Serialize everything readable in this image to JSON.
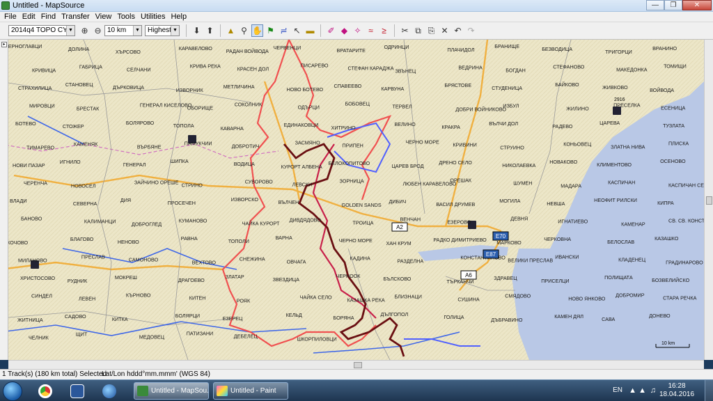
{
  "window": {
    "title": "Untitled - MapSource"
  },
  "menu": [
    "File",
    "Edit",
    "Find",
    "Transfer",
    "View",
    "Tools",
    "Utilities",
    "Help"
  ],
  "toolbar": {
    "map_product": "2014q4 TOPO CYR",
    "zoom_scale": "10 km",
    "detail_level": "Highest"
  },
  "map": {
    "labels": [
      "ЧЕРНОГЛАВЦИ",
      "ДОЛИНА",
      "ХЪРСОВО",
      "КАРАВЕЛОВО",
      "РАДАН ВОЙВОДА",
      "ЧЕРВЕНЦИ",
      "ВРАТАРИТЕ",
      "ОДРИНЦИ",
      "ПЛАЧИДОЛ",
      "БРАНИЩЕ",
      "БЕЗВОДИЦА",
      "ТРИГОРЦИ",
      "ВРАНИНО",
      "КРИВИЦА",
      "ГАБРИЦА",
      "СЕЛЧАНИ",
      "КРИВА РЕКА",
      "КРАСЕН ДОЛ",
      "ПИСАРЕВО",
      "СТЕФАН КАРАДЖА",
      "ЗВЪНЕЦ",
      "ВЕДРИНА",
      "БОГДАН",
      "СТЕФАНОВО",
      "МАКЕДОНКА",
      "ТОМИЩИ",
      "СТРАХИЛИЦА",
      "СТАНОВЕЦ",
      "ДЪРКОВИЦА",
      "ИЗВОРНИК",
      "МЕТЛИЧИНА",
      "НОВО БОТЕВО",
      "СПАВЕЕВО",
      "КАРВУНА",
      "БРЯСТОВЕ",
      "СТУДЕНИЦА",
      "БАЙКОВО",
      "ЖИВКОВО",
      "ВОЙВОДА",
      "МИРОВЦИ",
      "БРЕСТАК",
      "ГЕНЕРАЛ КИСЕЛОВО",
      "ОБОРИЩЕ",
      "СОКОЛНИК",
      "ОДЪРЦИ",
      "БОБОВЕЦ",
      "ТЕРВЕЛ",
      "ДОБРИ ВОЙНИКОВО",
      "ИЗБУЛ",
      "ЖИЛИНО",
      "ПРЕСЕЛКА",
      "ЕСЕНИЦА",
      "БОТЕВО",
      "СТОЖЕР",
      "БОЛЯРОВО",
      "ТОПОЛА",
      "КАВАРНА",
      "ЕДИНАКОВЦИ",
      "ХИТРИНО",
      "ВЕЛИНО",
      "КРАКРА",
      "ВЪЛЧИ ДОЛ",
      "РАДЕВО",
      "ЦАРЕВА",
      "ТУЗЛАТА",
      "ТИМАРЕВО",
      "КАМЕНЯК",
      "ВЪРБЯНЕ",
      "ПАМУКЧИИ",
      "ДОБРОТИЧ",
      "ЗАСМЯНО",
      "ПРИПЕН",
      "ЧЕРНО МОРЕ",
      "КРИВИНИ",
      "СТРУИНО",
      "КОНЬОВЕЦ",
      "ЗЛАТНА НИВА",
      "ПЛИСКА",
      "НОВИ ПАЗАР",
      "ИГНИЛО",
      "ГЕНЕРАЛ",
      "ШИПКА",
      "ВОДИЦА",
      "КУРОРТ АЛБЕНА",
      "БЕЛОКОПИТОВО",
      "ЦАРЕВ БРОД",
      "ДРЕНО СЕЛО",
      "НИКОЛАЕВКА",
      "НОВАКОВО",
      "КЛИМЕНТОВО",
      "ОСЕНОВО",
      "ЧЕРЕНЧА",
      "НОВОСЕЛ",
      "ЗАЙЧИНО ОРЕШЕ",
      "СТРИНО",
      "СУВОРОВО",
      "ЛЕВСКИ",
      "ЗОРНИЦА",
      "ЛЮБЕН КАРАВЕЛОВО",
      "ОРЕШАК",
      "ШУМЕН",
      "МАДАРА",
      "КАСПИЧАН",
      "КАСПИЧАН СЕЛО",
      "ВЛАДИ",
      "СЕВЕРНА",
      "ДИЯ",
      "ПРОСЕЧЕН",
      "ИЗВОРСКО",
      "ВЪЛЧЕН",
      "GOLDEN SANDS",
      "ДИБИЧ",
      "ВАСИЛ ДРУМЕВ",
      "МОГИЛА",
      "НЕВША",
      "НЕОФИТ РИЛСКИ",
      "КИПРА",
      "БАНОВО",
      "КАЛИМАНЦИ",
      "ДОБРОГЛЕД",
      "КУМАНОВО",
      "ЧАЙКА КУРОРТ",
      "ДИВДЯДОВО",
      "ТРОИЦА",
      "ВЕНЧАН",
      "ЕЗЕРОВО",
      "ДЕВНЯ",
      "ИГНАТИЕВО",
      "КАМЕНАР",
      "СВ. СВ. КОНСТАНТИН И ЕЛЕНА",
      "КОЧОВО",
      "БЛАГОВО",
      "НЕНОВО",
      "РАВНА",
      "ТОПОЛИ",
      "ВАРНА",
      "ЧЕРНО МОРЕ",
      "ХАН КРУМ",
      "РАДКО ДИМИТРИЕВО",
      "МАРКОВО",
      "ЧЕРКОВНА",
      "БЕЛОСЛАВ",
      "КАЗАШКО",
      "МИЛАНОВО",
      "ПРЕСЛАВ",
      "САМОНОВО",
      "ВЕХТОВО",
      "СНЕЖИНА",
      "ОВЧАГА",
      "КАДИНА",
      "РАЗДЕЛНА",
      "КОНСТАНТИНОВО",
      "ВЕЛИКИ ПРЕСЛАВ",
      "ИВАНСКИ",
      "КЛАДЕНЕЦ",
      "ГРАДИНАРОВО",
      "ХРИСТОСОВО",
      "РУДНИК",
      "МОКРЕШ",
      "ДРАГОЕВО",
      "ЗЛАТАР",
      "ЗВЕЗДИЦА",
      "ЧЕРНООК",
      "БЪЛСКОВО",
      "ТЪРКАНЧИ",
      "ЗДРАВЕЦ",
      "ПРИСЕЛЦИ",
      "ПОЛИЩАТА",
      "БОЗВЕЛИЙСКО",
      "СИНДЕЛ",
      "ЛЕВЕН",
      "КЪРНОВО",
      "КИТЕН",
      "РОЯК",
      "ЧАЙКА СЕЛО",
      "КАЗАШКА РЕКА",
      "БЛИЗНАЦИ",
      "СУШИНА",
      "СМЯДОВО",
      "НОВО ЯНКОВО",
      "ДОБРОМИР",
      "СТАРА РЕЧКА",
      "ЖИТНИЦА",
      "САДОВО",
      "КИТКА",
      "БОЛЯРЦИ",
      "ЕЗЕРЕЦ",
      "КЕЛЬД",
      "БОРЯНА",
      "ДЪЛГОПОЛ",
      "ГОЛИЦА",
      "ДЪБРАВИНО",
      "КАМЕН ДЯЛ",
      "САВА",
      "ДОНЕВО",
      "ЧЕЛНИК",
      "ЩИТ",
      "МЕДОВЕЦ",
      "ПАТИЗАНИ",
      "ДЕБЕЛЕЦ",
      "ШКОРПИЛОВЦИ"
    ],
    "road_labels": [
      "E70",
      "E87",
      "A2",
      "A6"
    ],
    "scale_label": "10 km",
    "elevation_label": "2916"
  },
  "status": {
    "selection": "1 Track(s) (180 km total) Selected",
    "position_format": "Lat/Lon hddd°mm.mmm' (WGS 84)"
  },
  "taskbar": {
    "tasks": [
      {
        "label": "Untitled - MapSou...",
        "active": true
      },
      {
        "label": "Untitled - Paint",
        "active": false
      }
    ],
    "language": "EN",
    "time": "16:28",
    "date": "18.04.2016"
  },
  "colors": {
    "map_land": "#ece6c8",
    "sea": "#b9c8e6",
    "track_dark": "#6a0f12",
    "track_red": "#f05050",
    "track_crimson": "#c8204a",
    "track_blue": "#5060ff",
    "road_orange": "#f0b040",
    "river_blue": "#4068e8"
  }
}
